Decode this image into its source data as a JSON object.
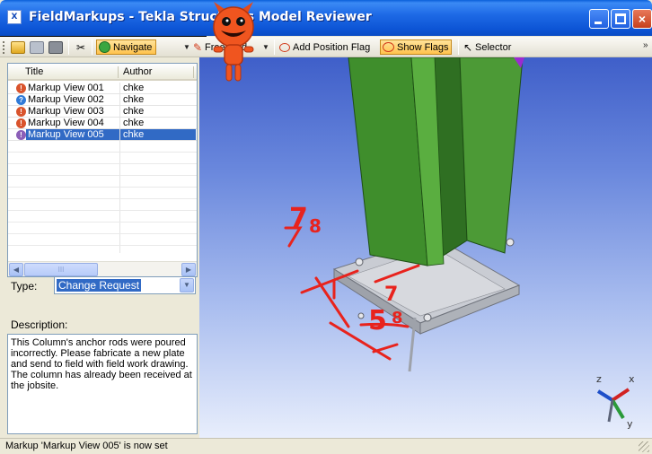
{
  "window": {
    "title": "FieldMarkups - Tekla Structures Model Reviewer",
    "icon": "tekla-app-icon",
    "controls": {
      "minimize": "minimize",
      "maximize": "maximize",
      "close": "×"
    }
  },
  "toolbar": {
    "navigate_label": "Navigate",
    "freehand_label": "Freehand",
    "add_position_flag_label": "Add Position Flag",
    "show_flags_label": "Show Flags",
    "selector_label": "Selector",
    "icons": [
      "open-folder-icon",
      "save-icon",
      "print-icon",
      "cut-icon",
      "navigate-icon",
      "pen-icon",
      "flag-icon",
      "show-flags-icon",
      "cursor-icon"
    ]
  },
  "markups": {
    "columns": [
      "Title",
      "Author"
    ],
    "rows": [
      {
        "title": "Markup View 001",
        "author": "chke",
        "status": "!",
        "status_color": "#d9532c",
        "selected": false
      },
      {
        "title": "Markup View 002",
        "author": "chke",
        "status": "?",
        "status_color": "#2f7ad8",
        "selected": false
      },
      {
        "title": "Markup View 003",
        "author": "chke",
        "status": "!",
        "status_color": "#d9532c",
        "selected": false
      },
      {
        "title": "Markup View 004",
        "author": "chke",
        "status": "!",
        "status_color": "#d9532c",
        "selected": false
      },
      {
        "title": "Markup View 005",
        "author": "chke",
        "status": "!",
        "status_color": "#8c5fb8",
        "selected": true
      }
    ],
    "scroll_thumb": "III"
  },
  "details": {
    "type_label": "Type:",
    "type_value": "Change Request",
    "description_label": "Description:",
    "description": "This Column's anchor rods were poured incorrectly. Please fabricate a new plate and send to field with field work drawing. The column has already been received at the jobsite."
  },
  "viewport": {
    "annotations": [
      "7",
      "8",
      "7",
      "5",
      "8"
    ]
  },
  "status": {
    "message": "Markup 'Markup View 005' is now set"
  },
  "colors": {
    "titlebar": "#0d55d6",
    "selection": "#316ac5",
    "highlight_button": "#ffc34d",
    "column_green": "#3c8a2a",
    "markup_red": "#e8231d"
  }
}
